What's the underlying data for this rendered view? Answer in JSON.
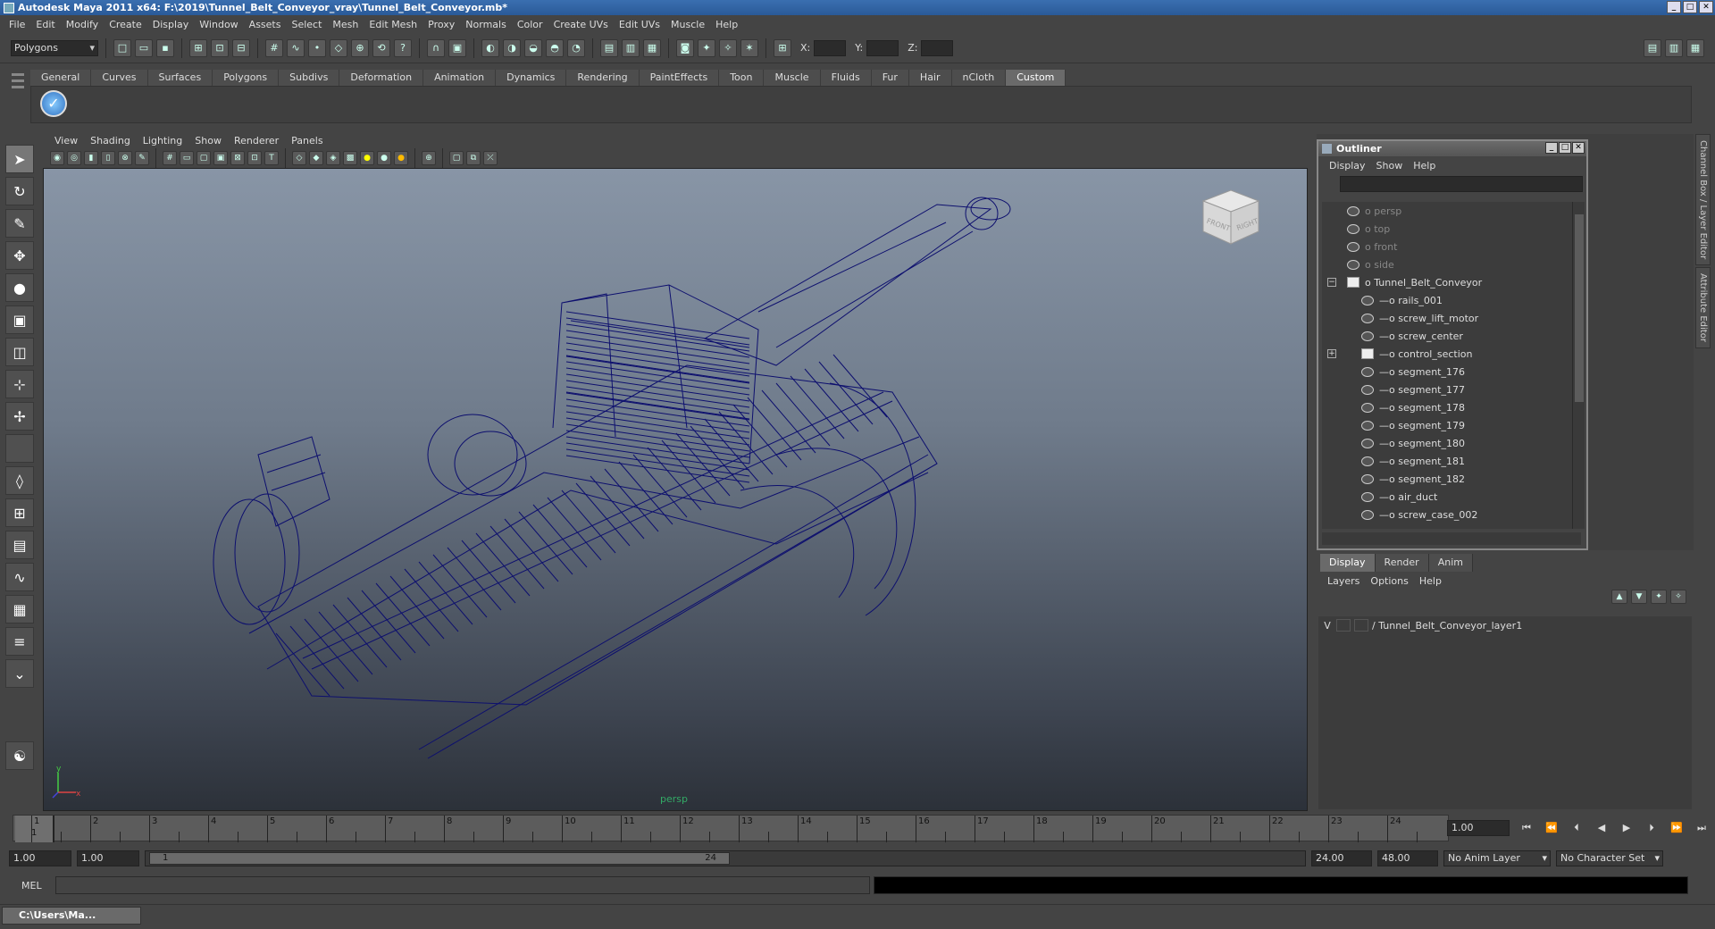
{
  "window": {
    "title": "Autodesk Maya 2011 x64: F:\\2019\\Tunnel_Belt_Conveyor_vray\\Tunnel_Belt_Conveyor.mb*"
  },
  "menus": [
    "File",
    "Edit",
    "Modify",
    "Create",
    "Display",
    "Window",
    "Assets",
    "Select",
    "Mesh",
    "Edit Mesh",
    "Proxy",
    "Normals",
    "Color",
    "Create UVs",
    "Edit UVs",
    "Muscle",
    "Help"
  ],
  "statusline": {
    "mode": "Polygons",
    "x_label": "X:",
    "y_label": "Y:",
    "z_label": "Z:"
  },
  "shelf": {
    "tabs": [
      "General",
      "Curves",
      "Surfaces",
      "Polygons",
      "Subdivs",
      "Deformation",
      "Animation",
      "Dynamics",
      "Rendering",
      "PaintEffects",
      "Toon",
      "Muscle",
      "Fluids",
      "Fur",
      "Hair",
      "nCloth",
      "Custom"
    ],
    "active_tab": "Custom"
  },
  "viewport": {
    "menu": [
      "View",
      "Shading",
      "Lighting",
      "Show",
      "Renderer",
      "Panels"
    ],
    "camera": "persp",
    "cube_front": "FRONT",
    "cube_right": "RIGHT",
    "wire_color": "#0d0f6e"
  },
  "outliner": {
    "title": "Outliner",
    "menu": [
      "Display",
      "Show",
      "Help"
    ],
    "items": [
      {
        "label": "persp",
        "kind": "camera",
        "indent": 0
      },
      {
        "label": "top",
        "kind": "camera",
        "indent": 0
      },
      {
        "label": "front",
        "kind": "camera",
        "indent": 0
      },
      {
        "label": "side",
        "kind": "camera",
        "indent": 0
      },
      {
        "label": "Tunnel_Belt_Conveyor",
        "kind": "group",
        "indent": 0,
        "expander": "−"
      },
      {
        "label": "rails_001",
        "kind": "mesh",
        "indent": 1
      },
      {
        "label": "screw_lift_motor",
        "kind": "mesh",
        "indent": 1
      },
      {
        "label": "screw_center",
        "kind": "mesh",
        "indent": 1
      },
      {
        "label": "control_section",
        "kind": "group",
        "indent": 1,
        "expander": "+"
      },
      {
        "label": "segment_176",
        "kind": "mesh",
        "indent": 1
      },
      {
        "label": "segment_177",
        "kind": "mesh",
        "indent": 1
      },
      {
        "label": "segment_178",
        "kind": "mesh",
        "indent": 1
      },
      {
        "label": "segment_179",
        "kind": "mesh",
        "indent": 1
      },
      {
        "label": "segment_180",
        "kind": "mesh",
        "indent": 1
      },
      {
        "label": "segment_181",
        "kind": "mesh",
        "indent": 1
      },
      {
        "label": "segment_182",
        "kind": "mesh",
        "indent": 1
      },
      {
        "label": "air_duct",
        "kind": "mesh",
        "indent": 1
      },
      {
        "label": "screw_case_002",
        "kind": "mesh",
        "indent": 1
      }
    ]
  },
  "side_tabs": [
    "Channel Box / Layer Editor",
    "Attribute Editor"
  ],
  "layers": {
    "tabs": [
      "Display",
      "Render",
      "Anim"
    ],
    "active_tab": "Display",
    "menu": [
      "Layers",
      "Options",
      "Help"
    ],
    "items": [
      {
        "visible": "V",
        "name": "Tunnel_Belt_Conveyor_layer1"
      }
    ]
  },
  "timeline": {
    "ticks": [
      "1",
      "2",
      "3",
      "4",
      "5",
      "6",
      "7",
      "8",
      "9",
      "10",
      "11",
      "12",
      "13",
      "14",
      "15",
      "16",
      "17",
      "18",
      "19",
      "20",
      "21",
      "22",
      "23",
      "24"
    ],
    "current_marker": "1",
    "current_frame": "1.00"
  },
  "range": {
    "start": "1.00",
    "playback_start": "1.00",
    "thumb_start": "1",
    "thumb_end": "24",
    "playback_end": "24.00",
    "end": "48.00",
    "anim_layer": "No Anim Layer",
    "char_set": "No Character Set"
  },
  "command": {
    "label": "MEL"
  },
  "taskbar": {
    "label": "C:\\Users\\Ma..."
  }
}
